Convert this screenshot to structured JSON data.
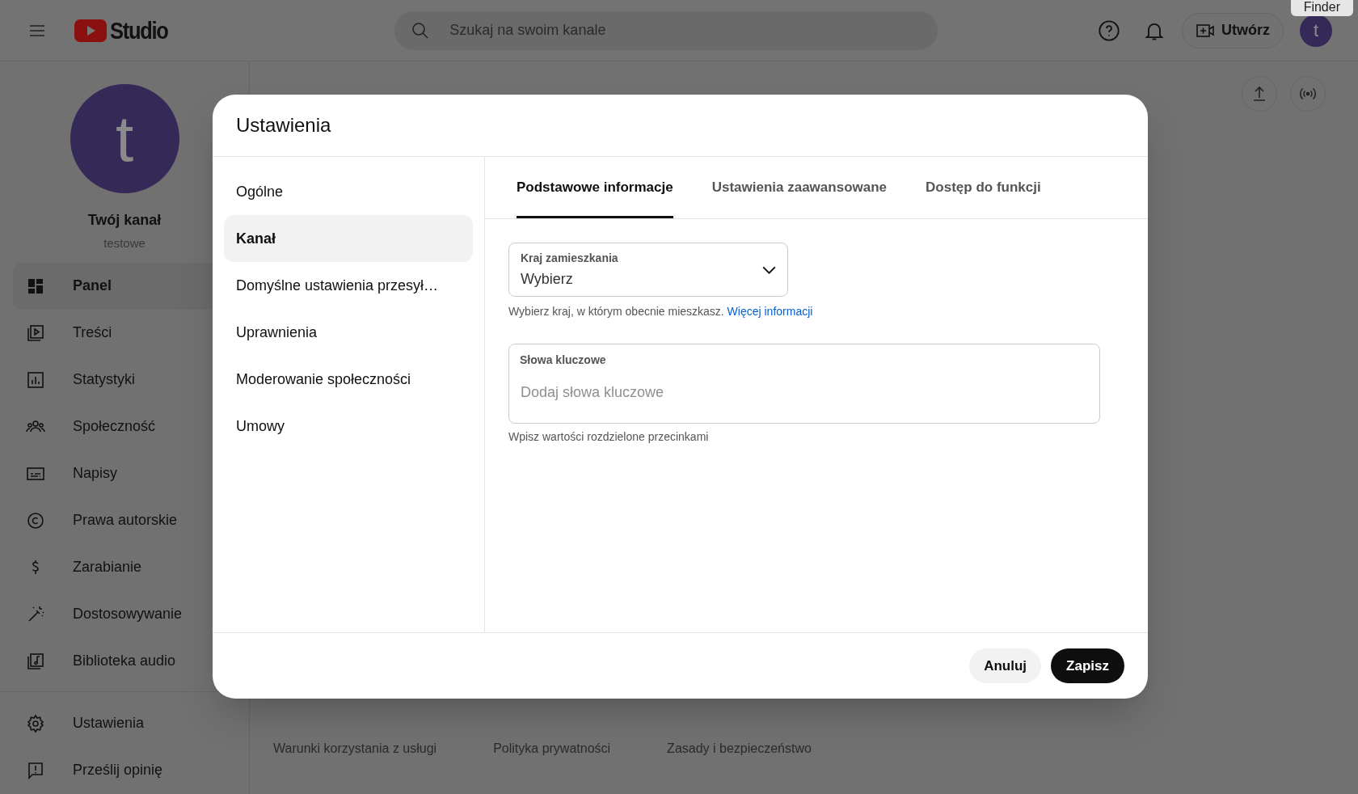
{
  "header": {
    "logo_text": "Studio",
    "search": {
      "placeholder": "Szukaj na swoim kanale"
    },
    "create_button": "Utwórz",
    "avatar_letter": "t"
  },
  "tooltip": "Finder",
  "channel": {
    "avatar_letter": "t",
    "name": "Twój kanał",
    "handle": "testowe"
  },
  "sidebar": {
    "items": [
      {
        "label": "Panel",
        "selected": true
      },
      {
        "label": "Treści",
        "selected": false
      },
      {
        "label": "Statystyki",
        "selected": false
      },
      {
        "label": "Społeczność",
        "selected": false
      },
      {
        "label": "Napisy",
        "selected": false
      },
      {
        "label": "Prawa autorskie",
        "selected": false
      },
      {
        "label": "Zarabianie",
        "selected": false
      },
      {
        "label": "Dostosowywanie",
        "selected": false
      },
      {
        "label": "Biblioteka audio",
        "selected": false
      }
    ],
    "bottom_items": [
      {
        "label": "Ustawienia"
      },
      {
        "label": "Prześlij opinię"
      }
    ]
  },
  "footer_links": [
    "Warunki korzystania z usługi",
    "Polityka prywatności",
    "Zasady i bezpieczeństwo"
  ],
  "dialog": {
    "title": "Ustawienia",
    "nav": [
      {
        "label": "Ogólne",
        "selected": false
      },
      {
        "label": "Kanał",
        "selected": true
      },
      {
        "label": "Domyślne ustawienia przesył…",
        "selected": false
      },
      {
        "label": "Uprawnienia",
        "selected": false
      },
      {
        "label": "Moderowanie społeczności",
        "selected": false
      },
      {
        "label": "Umowy",
        "selected": false
      }
    ],
    "tabs": [
      {
        "label": "Podstawowe informacje",
        "selected": true
      },
      {
        "label": "Ustawienia zaawansowane",
        "selected": false
      },
      {
        "label": "Dostęp do funkcji",
        "selected": false
      }
    ],
    "country_select": {
      "label": "Kraj zamieszkania",
      "value": "Wybierz"
    },
    "country_help": {
      "text": "Wybierz kraj, w którym obecnie mieszkasz.",
      "link": "Więcej informacji"
    },
    "keywords": {
      "label": "Słowa kluczowe",
      "placeholder": "Dodaj słowa kluczowe",
      "help": "Wpisz wartości rozdzielone przecinkami"
    },
    "buttons": {
      "cancel": "Anuluj",
      "save": "Zapisz"
    }
  }
}
